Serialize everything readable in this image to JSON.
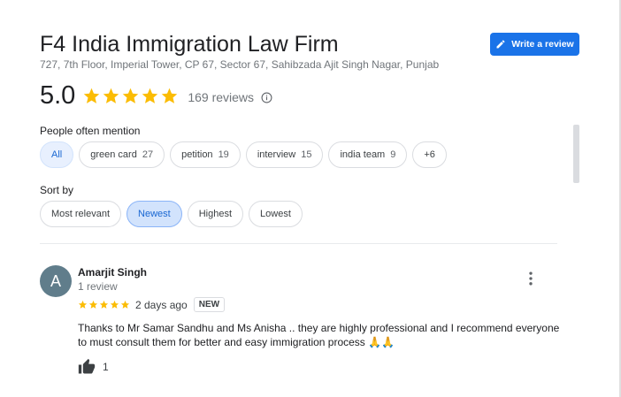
{
  "business": {
    "name": "F4 India Immigration Law Firm",
    "address": "727, 7th Floor, Imperial Tower, CP 67, Sector 67, Sahibzada Ajit Singh Nagar, Punjab",
    "write_review_label": "Write a review"
  },
  "rating": {
    "value": "5.0",
    "stars": 5,
    "review_count_text": "169 reviews"
  },
  "mentions": {
    "label": "People often mention",
    "chips": [
      {
        "label": "All",
        "count": ""
      },
      {
        "label": "green card",
        "count": "27"
      },
      {
        "label": "petition",
        "count": "19"
      },
      {
        "label": "interview",
        "count": "15"
      },
      {
        "label": "india team",
        "count": "9"
      },
      {
        "label": "+6",
        "count": ""
      }
    ],
    "active": "All"
  },
  "sort": {
    "label": "Sort by",
    "options": [
      "Most relevant",
      "Newest",
      "Highest",
      "Lowest"
    ],
    "active": "Newest"
  },
  "reviews": [
    {
      "avatar_letter": "A",
      "name": "Amarjit Singh",
      "sub": "1 review",
      "stars": 5,
      "time": "2 days ago",
      "badge": "NEW",
      "text": "Thanks to Mr Samar Sandhu and Ms Anisha .. they are highly professional and I recommend everyone to must consult them for better and easy immigration process 🙏🙏",
      "likes": "1"
    }
  ],
  "colors": {
    "accent": "#1a73e8",
    "star": "#fbbc04",
    "avatar": "#607d8b"
  }
}
